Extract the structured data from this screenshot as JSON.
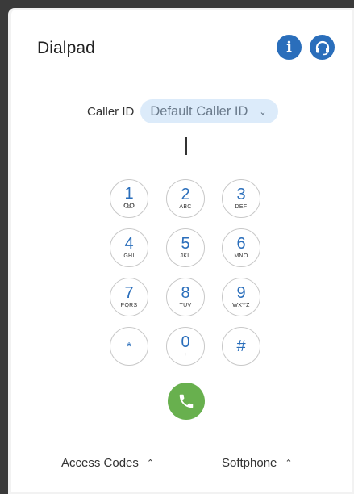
{
  "header": {
    "title": "Dialpad",
    "info_icon": "info-icon",
    "support_icon": "headset-icon",
    "accent_color": "#2a6ebb"
  },
  "caller_id": {
    "label": "Caller ID",
    "selected": "Default Caller ID",
    "chevron": "chevron-down-icon"
  },
  "number_input": {
    "value": ""
  },
  "keys": [
    {
      "digit": "1",
      "letters": "ωω"
    },
    {
      "digit": "2",
      "letters": "ABC"
    },
    {
      "digit": "3",
      "letters": "DEF"
    },
    {
      "digit": "4",
      "letters": "GHI"
    },
    {
      "digit": "5",
      "letters": "JKL"
    },
    {
      "digit": "6",
      "letters": "MNO"
    },
    {
      "digit": "7",
      "letters": "PQRS"
    },
    {
      "digit": "8",
      "letters": "TUV"
    },
    {
      "digit": "9",
      "letters": "WXYZ"
    },
    {
      "digit": "*",
      "letters": ""
    },
    {
      "digit": "0",
      "letters": "+"
    },
    {
      "digit": "#",
      "letters": ""
    }
  ],
  "call_button": {
    "icon": "phone-icon",
    "color": "#68b04e"
  },
  "footer": {
    "access_codes": "Access Codes",
    "softphone": "Softphone"
  }
}
